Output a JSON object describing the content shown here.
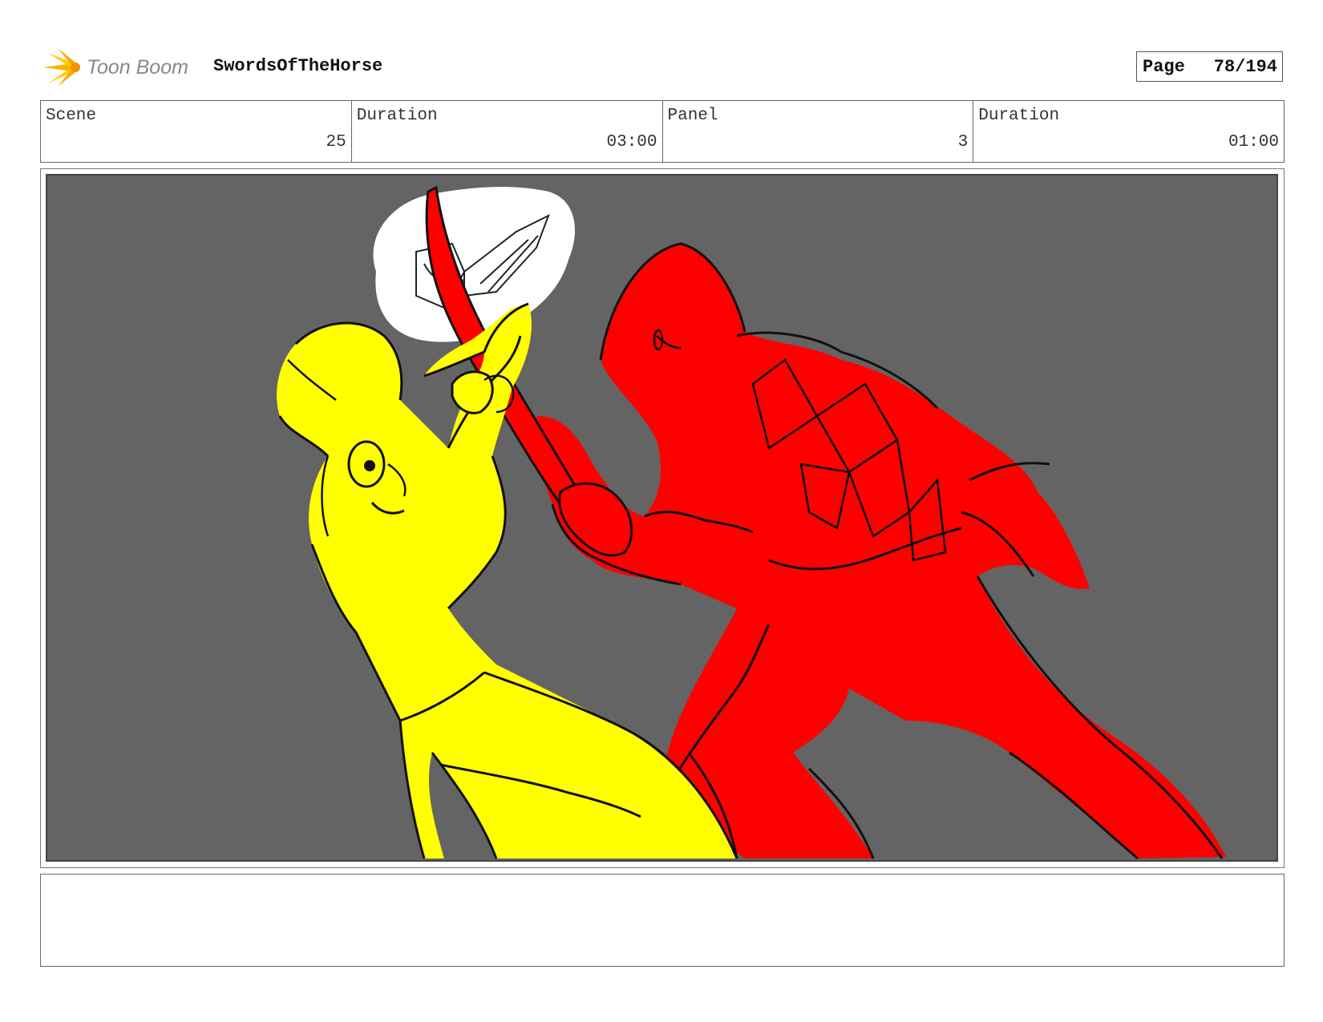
{
  "header": {
    "logo_text": "Toon Boom",
    "project_title": "SwordsOfTheHorse",
    "page_label": "Page",
    "page_number": "78/194"
  },
  "info": {
    "scene_label": "Scene",
    "scene_value": "25",
    "scene_duration_label": "Duration",
    "scene_duration_value": "03:00",
    "panel_label": "Panel",
    "panel_value": "3",
    "panel_duration_label": "Duration",
    "panel_duration_value": "01:00"
  },
  "panel": {
    "background_color": "#646464",
    "left_character_color": "#ffff00",
    "right_character_color": "#ff0000",
    "highlight_color": "#ffffff"
  },
  "notes": {
    "text": ""
  }
}
